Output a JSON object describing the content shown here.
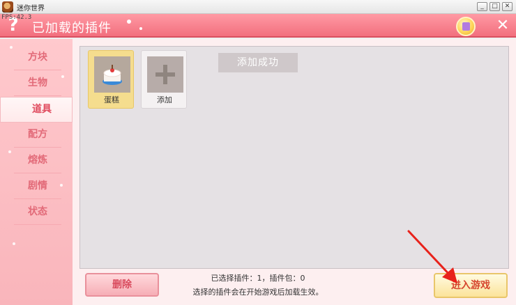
{
  "window": {
    "title": "迷你世界",
    "fps": "FPS:42.3",
    "min_glyph": "_",
    "max_glyph": "□",
    "close_glyph": "✕"
  },
  "header": {
    "help_glyph": "?",
    "title": "已加载的插件",
    "close_glyph": "✕"
  },
  "sidebar": {
    "items": [
      {
        "label": "方块"
      },
      {
        "label": "生物"
      },
      {
        "label": "道具"
      },
      {
        "label": "配方"
      },
      {
        "label": "熔炼"
      },
      {
        "label": "剧情"
      },
      {
        "label": "状态"
      }
    ],
    "active_index": 2
  },
  "plugins": [
    {
      "label": "蛋糕",
      "icon": "cake-icon",
      "selected": true
    },
    {
      "label": "添加",
      "icon": "plus-icon",
      "selected": false
    }
  ],
  "toast": "添加成功",
  "footer": {
    "delete_label": "删除",
    "status_line_1": "已选择插件：1，插件包：0",
    "status_line_2": "选择的插件会在开始游戏后加载生效。",
    "enter_label": "进入游戏"
  },
  "colors": {
    "header": "#f26f7e",
    "sidebar": "#ffc9cd",
    "selected_card": "#f5dd8e",
    "arrow": "#e8221b"
  }
}
